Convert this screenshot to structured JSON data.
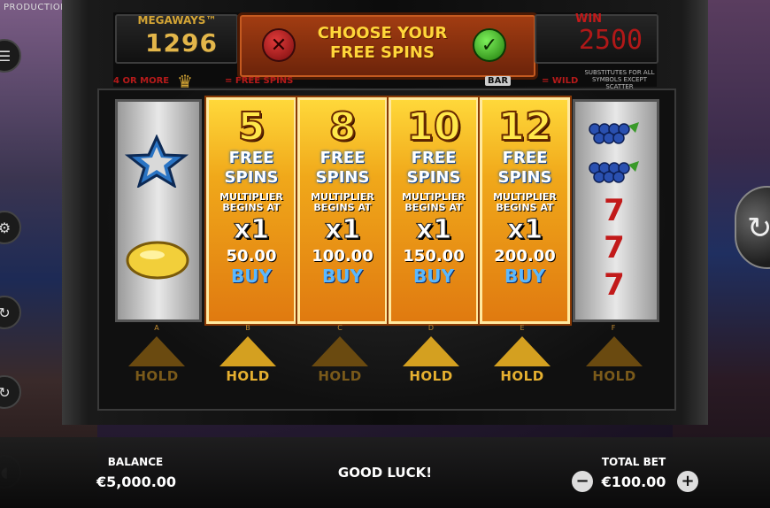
{
  "provider": "PRODUCTION",
  "header": {
    "megaways_title": "MEGAWAYS™",
    "megaways_value": "1296",
    "choose_title_line1": "CHOOSE YOUR",
    "choose_title_line2": "FREE SPINS",
    "cancel_symbol": "✕",
    "confirm_symbol": "✓",
    "win_label": "WIN",
    "win_value": "2500"
  },
  "info": {
    "four_or_more": "4 OR MORE",
    "free_spins": "= FREE SPINS",
    "bar_label": "BAR",
    "wild": "= WILD",
    "substitutes": "SUBSTITUTES FOR ALL SYMBOLS EXCEPT SCATTER"
  },
  "offers": [
    {
      "spins": "5",
      "free": "FREE",
      "spins_label": "SPINS",
      "mult_line1": "MULTIPLIER",
      "mult_line2": "BEGINS AT",
      "mult": "x1",
      "price": "50.00",
      "buy": "BUY"
    },
    {
      "spins": "8",
      "free": "FREE",
      "spins_label": "SPINS",
      "mult_line1": "MULTIPLIER",
      "mult_line2": "BEGINS AT",
      "mult": "x1",
      "price": "100.00",
      "buy": "BUY"
    },
    {
      "spins": "10",
      "free": "FREE",
      "spins_label": "SPINS",
      "mult_line1": "MULTIPLIER",
      "mult_line2": "BEGINS AT",
      "mult": "x1",
      "price": "150.00",
      "buy": "BUY"
    },
    {
      "spins": "12",
      "free": "FREE",
      "spins_label": "SPINS",
      "mult_line1": "MULTIPLIER",
      "mult_line2": "BEGINS AT",
      "mult": "x1",
      "price": "200.00",
      "buy": "BUY"
    }
  ],
  "reels": {
    "letters": [
      "A",
      "B",
      "C",
      "D",
      "E",
      "F"
    ],
    "hold_label": "HOLD",
    "reel_a_symbols": [
      "star-icon",
      "lemon-icon"
    ],
    "reel_f_symbols": [
      "grapes-icon",
      "grapes-icon",
      "seven-icon",
      "seven-icon",
      "seven-icon"
    ]
  },
  "footer": {
    "balance_label": "BALANCE",
    "balance_value": "€5,000.00",
    "message": "GOOD LUCK!",
    "total_bet_label": "TOTAL BET",
    "total_bet_value": "€100.00",
    "minus": "−",
    "plus": "+"
  },
  "colors": {
    "accent_gold": "#ffd63a",
    "win_red": "#b01818",
    "buy_blue": "#5ab8ff"
  }
}
